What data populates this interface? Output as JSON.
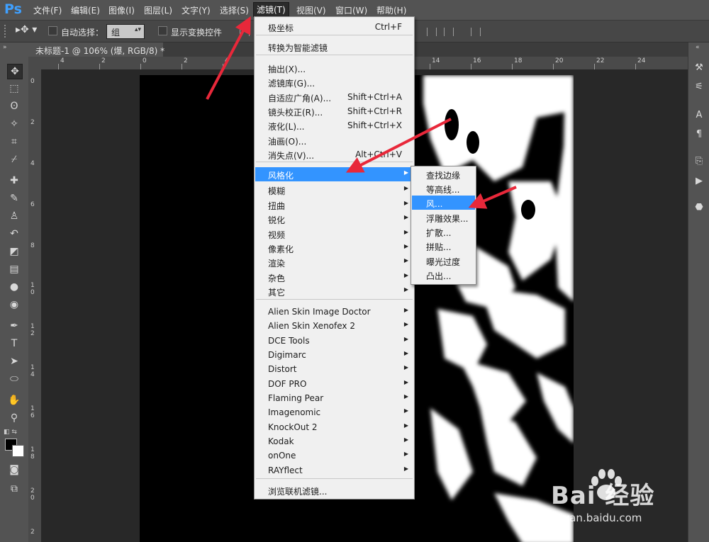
{
  "app": {
    "logo": "Ps"
  },
  "menubar": {
    "items": [
      "文件(F)",
      "编辑(E)",
      "图像(I)",
      "图层(L)",
      "文字(Y)",
      "选择(S)",
      "滤镜(T)",
      "视图(V)",
      "窗口(W)",
      "帮助(H)"
    ],
    "active": "滤镜(T)"
  },
  "options": {
    "auto_select_label": "自动选择：",
    "auto_select_value": "组",
    "show_transform_label": "显示变换控件"
  },
  "tab": {
    "title": "未标题-1 @ 106% (爆, RGB/8) *"
  },
  "ruler": {
    "h_labels": [
      "4",
      "2",
      "0",
      "2",
      "4",
      "14",
      "16",
      "18",
      "20",
      "22",
      "24"
    ],
    "v_labels": [
      "0",
      "2",
      "4",
      "6",
      "8",
      "1 0",
      "1 2",
      "1 4",
      "1 6",
      "1 8",
      "2 0",
      "2"
    ]
  },
  "filter_menu": {
    "items": [
      {
        "label": "极坐标",
        "shortcut": "Ctrl+F"
      },
      {
        "label": "转换为智能滤镜"
      },
      {
        "label": "抽出(X)..."
      },
      {
        "label": "滤镜库(G)..."
      },
      {
        "label": "自适应广角(A)...",
        "shortcut": "Shift+Ctrl+A"
      },
      {
        "label": "镜头校正(R)...",
        "shortcut": "Shift+Ctrl+R"
      },
      {
        "label": "液化(L)...",
        "shortcut": "Shift+Ctrl+X"
      },
      {
        "label": "油画(O)..."
      },
      {
        "label": "消失点(V)...",
        "shortcut": "Alt+Ctrl+V"
      },
      {
        "label": "风格化",
        "submenu": true,
        "highlighted": true
      },
      {
        "label": "模糊",
        "submenu": true
      },
      {
        "label": "扭曲",
        "submenu": true
      },
      {
        "label": "锐化",
        "submenu": true
      },
      {
        "label": "视频",
        "submenu": true
      },
      {
        "label": "像素化",
        "submenu": true
      },
      {
        "label": "渲染",
        "submenu": true
      },
      {
        "label": "杂色",
        "submenu": true
      },
      {
        "label": "其它",
        "submenu": true
      },
      {
        "label": "Alien Skin Image Doctor",
        "submenu": true
      },
      {
        "label": "Alien Skin Xenofex 2",
        "submenu": true
      },
      {
        "label": "DCE Tools",
        "submenu": true
      },
      {
        "label": "Digimarc",
        "submenu": true
      },
      {
        "label": "Distort",
        "submenu": true
      },
      {
        "label": "DOF PRO",
        "submenu": true
      },
      {
        "label": "Flaming Pear",
        "submenu": true
      },
      {
        "label": "Imagenomic",
        "submenu": true
      },
      {
        "label": "KnockOut 2",
        "submenu": true
      },
      {
        "label": "Kodak",
        "submenu": true
      },
      {
        "label": "onOne",
        "submenu": true
      },
      {
        "label": "RAYflect",
        "submenu": true
      },
      {
        "label": "浏览联机滤镜..."
      }
    ]
  },
  "stylize_submenu": {
    "items": [
      {
        "label": "查找边缘"
      },
      {
        "label": "等高线..."
      },
      {
        "label": "风...",
        "highlighted": true
      },
      {
        "label": "浮雕效果..."
      },
      {
        "label": "扩散..."
      },
      {
        "label": "拼贴..."
      },
      {
        "label": "曝光过度"
      },
      {
        "label": "凸出..."
      }
    ]
  },
  "watermark": {
    "brand": "Bai 经验",
    "url": "jingyan.baidu.com"
  },
  "colors": {
    "accent": "#3394ff",
    "arrow": "#e8283a",
    "logo": "#3fa0ff"
  }
}
